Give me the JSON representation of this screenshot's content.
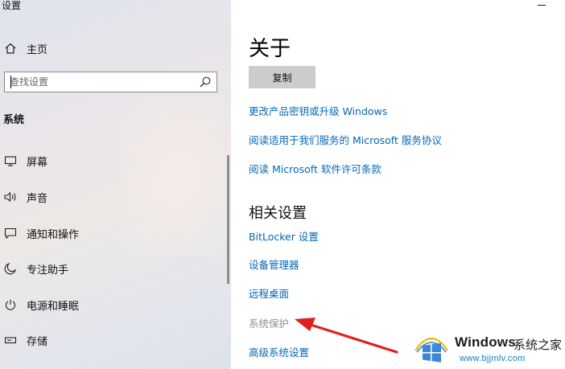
{
  "window": {
    "title": "设置"
  },
  "sidebar": {
    "home_label": "主页",
    "search_placeholder": "查找设置",
    "section_label": "系统",
    "items": [
      {
        "label": "屏幕",
        "icon": "monitor-icon"
      },
      {
        "label": "声音",
        "icon": "speaker-icon"
      },
      {
        "label": "通知和操作",
        "icon": "notification-icon"
      },
      {
        "label": "专注助手",
        "icon": "moon-icon"
      },
      {
        "label": "电源和睡眠",
        "icon": "power-icon"
      },
      {
        "label": "存储",
        "icon": "storage-icon"
      }
    ]
  },
  "main": {
    "title": "关于",
    "copy_button": "复制",
    "links": [
      "更改产品密钥或升级 Windows",
      "阅读适用于我们服务的 Microsoft 服务协议",
      "阅读 Microsoft 软件许可条款"
    ],
    "related_title": "相关设置",
    "related_links": [
      "BitLocker 设置",
      "设备管理器",
      "远程桌面",
      "系统保护",
      "高级系统设置"
    ]
  },
  "watermark": {
    "brand": "Windows",
    "cn_text": "系统之家",
    "url": "www.bjjmlv.com"
  },
  "colors": {
    "link": "#0067b8",
    "disabled_link": "#8f8f8f",
    "arrow": "#e02020"
  }
}
